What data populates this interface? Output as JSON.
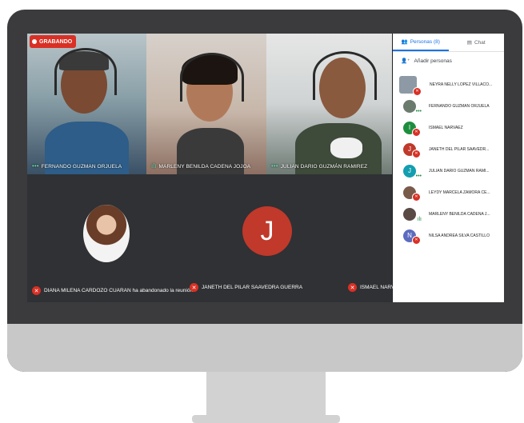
{
  "recording": {
    "label": "GRABANDO"
  },
  "tiles": [
    {
      "name": "FERNANDO GUZMAN ORJUELA"
    },
    {
      "name": "MARLENY BENILDA CADENA JOJOA"
    },
    {
      "name": "JULIAN DARIO GUZMÁN RAMIREZ"
    }
  ],
  "bottom": {
    "left_notice": "DIANA MILENA CARDOZO CUARAN ha abandonado la reunión",
    "center_name": "JANETH DEL PILAR SAAVEDRA GUERRA",
    "center_initial": "J",
    "right_name": "ISMAEL NARVA"
  },
  "panel": {
    "tab_people": "Personas (8)",
    "tab_chat": "Chat",
    "add_people": "Añadir personas",
    "participants": [
      {
        "name": "NEYRA NELLY LOPEZ VILLACO...",
        "initial": "",
        "color": "#8d9aa5"
      },
      {
        "name": "FERNANDO GUZMAN ORJUELA",
        "initial": "",
        "color": "#6b7b6e"
      },
      {
        "name": "ISMAEL NARVAEZ",
        "initial": "I",
        "color": "#1e8e3e"
      },
      {
        "name": "JANETH DEL PILAR SAAVEDR...",
        "initial": "J",
        "color": "#c0392b"
      },
      {
        "name": "JULIAN DARIO GUZMÁN RAMÍ...",
        "initial": "J",
        "color": "#129eaf"
      },
      {
        "name": "LEYDY MARCELA ZAMORA CE...",
        "initial": "",
        "color": "#7a5a4a"
      },
      {
        "name": "MARLENY BENILDA CADENA J...",
        "initial": "",
        "color": "#5a4a45"
      },
      {
        "name": "NILSA ANDREA SILVA CASTILLO",
        "initial": "N",
        "color": "#5c6bc0"
      }
    ]
  }
}
